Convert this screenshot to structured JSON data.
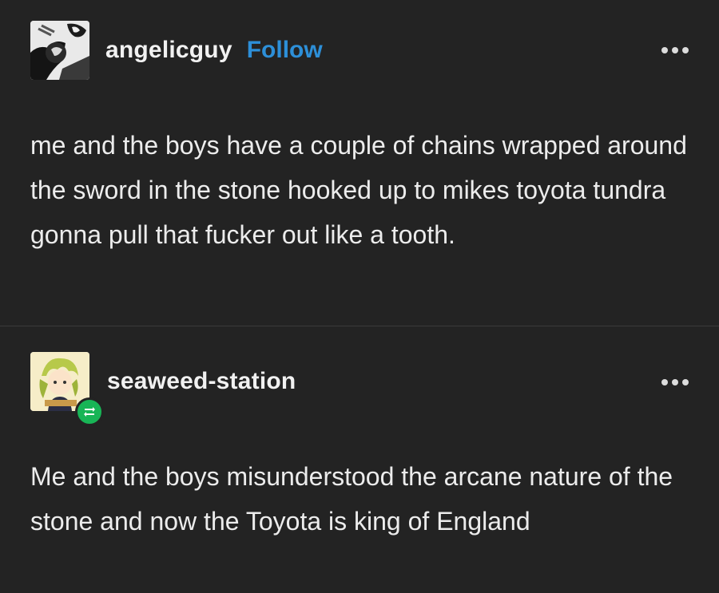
{
  "post1": {
    "username": "angelicguy",
    "follow_label": "Follow",
    "text": "me and the boys have a couple of chains wrapped around the sword in the stone hooked up to mikes toyota tundra gonna pull that fucker out like a tooth."
  },
  "post2": {
    "username": "seaweed-station",
    "text": "Me and the boys misunderstood the arcane nature of the stone and now the Toyota is king of England"
  },
  "colors": {
    "background": "#232323",
    "text": "#ececec",
    "follow_link": "#2d8fd8",
    "reblog_badge": "#18b556"
  },
  "icons": [
    "more-options-icon",
    "reblog-icon"
  ]
}
